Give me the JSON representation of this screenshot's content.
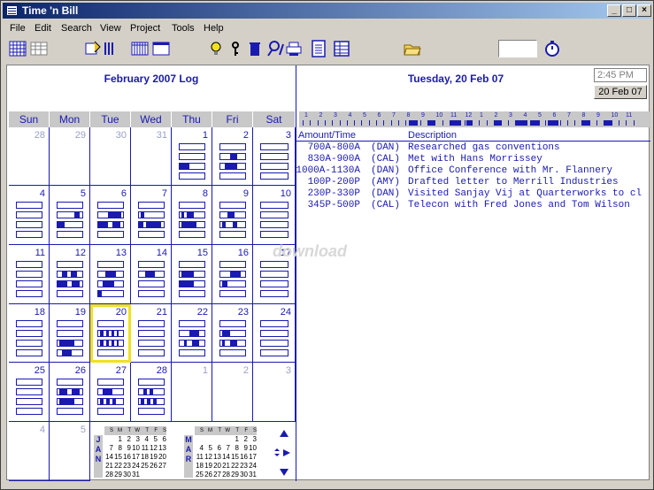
{
  "window": {
    "title": "Time 'n Bill"
  },
  "menu": [
    "File",
    "Edit",
    "Search",
    "View",
    "Project",
    "Tools",
    "Help"
  ],
  "toolbar": {
    "icons": [
      "grid-view-icon",
      "list-view-icon",
      "calendar-edit-icon",
      "columns-icon",
      "week-view-icon",
      "window-icon",
      "lightbulb-icon",
      "key-icon",
      "trash-icon",
      "search-icon",
      "printer-icon",
      "notes-icon",
      "report-icon",
      "folder-open-icon",
      "stopwatch-icon"
    ]
  },
  "calendar": {
    "title": "February 2007 Log",
    "days_of_week": [
      "Sun",
      "Mon",
      "Tue",
      "Wed",
      "Thu",
      "Fri",
      "Sat"
    ],
    "weeks": [
      [
        "28",
        "29",
        "30",
        "31",
        "1",
        "2",
        "3"
      ],
      [
        "4",
        "5",
        "6",
        "7",
        "8",
        "9",
        "10"
      ],
      [
        "11",
        "12",
        "13",
        "14",
        "15",
        "16",
        "17"
      ],
      [
        "18",
        "19",
        "20",
        "21",
        "22",
        "23",
        "24"
      ],
      [
        "25",
        "26",
        "27",
        "28",
        "1",
        "2",
        "3"
      ],
      [
        "4",
        "5",
        "",
        "",
        "",
        "",
        ""
      ]
    ]
  },
  "minicals": {
    "jan": {
      "label": [
        "J",
        "A",
        "N"
      ],
      "header": [
        "S",
        "M",
        "T",
        "W",
        "T",
        "F",
        "S"
      ],
      "rows": [
        [
          "",
          "1",
          "2",
          "3",
          "4",
          "5",
          "6"
        ],
        [
          "7",
          "8",
          "9",
          "10",
          "11",
          "12",
          "13"
        ],
        [
          "14",
          "15",
          "16",
          "17",
          "18",
          "19",
          "20"
        ],
        [
          "21",
          "22",
          "23",
          "24",
          "25",
          "26",
          "27"
        ],
        [
          "28",
          "29",
          "30",
          "31",
          "",
          "",
          ""
        ]
      ]
    },
    "mar": {
      "label": [
        "M",
        "A",
        "R"
      ],
      "header": [
        "S",
        "M",
        "T",
        "W",
        "T",
        "F",
        "S"
      ],
      "rows": [
        [
          "",
          "",
          "",
          "",
          "1",
          "2",
          "3"
        ],
        [
          "4",
          "5",
          "6",
          "7",
          "8",
          "9",
          "10"
        ],
        [
          "11",
          "12",
          "13",
          "14",
          "15",
          "16",
          "17"
        ],
        [
          "18",
          "19",
          "20",
          "21",
          "22",
          "23",
          "24"
        ],
        [
          "25",
          "26",
          "27",
          "28",
          "29",
          "30",
          "31"
        ]
      ]
    }
  },
  "day": {
    "title": "Tuesday, 20 Feb 07",
    "clock": "2:45 PM",
    "date_button": "20 Feb 07",
    "hours": [
      "1",
      "2",
      "3",
      "4",
      "5",
      "6",
      "7",
      "8",
      "9",
      "10",
      "11",
      "12",
      "1",
      "2",
      "3",
      "4",
      "5",
      "6",
      "7",
      "8",
      "9",
      "10",
      "11"
    ],
    "list_headers": {
      "amount": "Amount/Time",
      "description": "Description"
    },
    "entries": [
      {
        "time": "700A-800A",
        "who": "(DAN)",
        "desc": "Researched gas conventions"
      },
      {
        "time": "830A-900A",
        "who": "(CAL)",
        "desc": "Met with Hans Morrissey"
      },
      {
        "time": "1000A-1130A",
        "who": "(DAN)",
        "desc": "Office Conference with Mr. Flannery"
      },
      {
        "time": "100P-200P",
        "who": "(AMY)",
        "desc": "Drafted letter to Merrill Industries"
      },
      {
        "time": "230P-330P",
        "who": "(DAN)",
        "desc": "Visited Sanjay Vij at Quarterworks to cl"
      },
      {
        "time": "345P-500P",
        "who": "(CAL)",
        "desc": "Telecon with Fred Jones and Tom Wilson"
      }
    ]
  },
  "watermark": "download"
}
